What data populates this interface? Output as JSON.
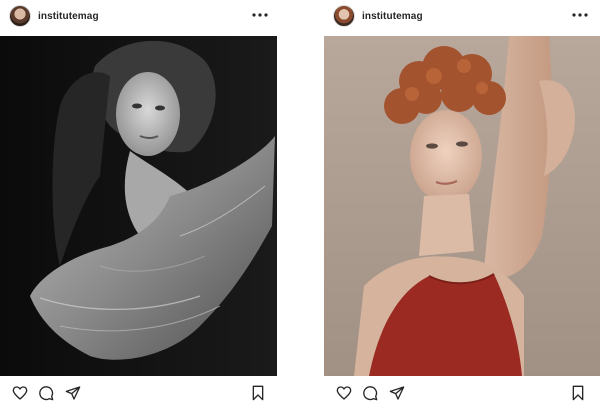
{
  "posts": [
    {
      "username": "institutemag",
      "photo": "black-and-white portrait of a woman in draped fabric",
      "actions": [
        "heart-icon",
        "comment-icon",
        "share-icon",
        "bookmark-icon"
      ]
    },
    {
      "username": "institutemag",
      "photo": "color portrait of a red-haired woman in a red top",
      "actions": [
        "heart-icon",
        "comment-icon",
        "share-icon",
        "bookmark-icon"
      ]
    }
  ],
  "colors": {
    "text": "#262626",
    "background": "#ffffff",
    "border": "#dbdbdb"
  }
}
